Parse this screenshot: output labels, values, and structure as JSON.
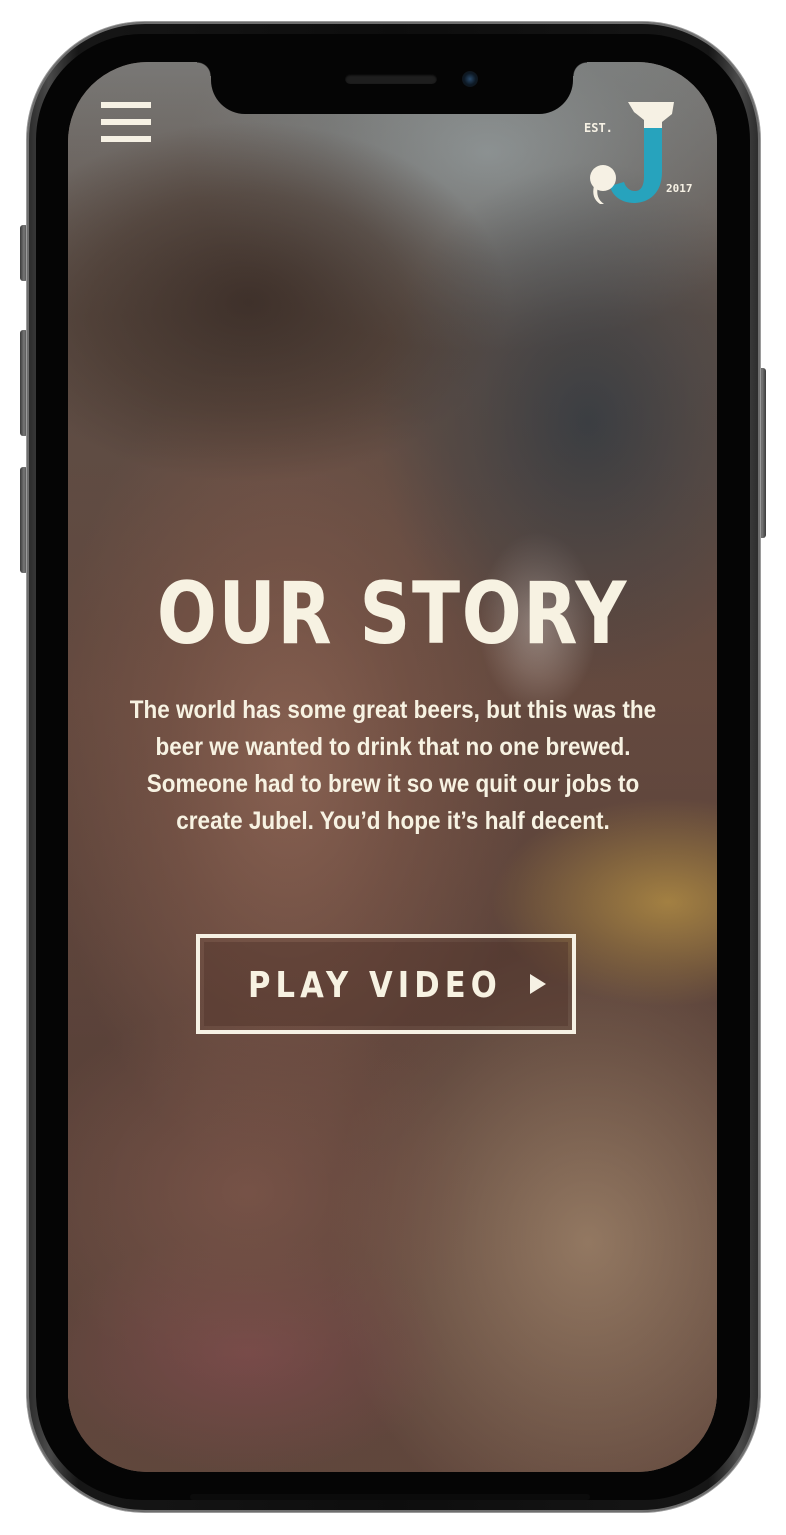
{
  "header": {
    "menu_icon": "hamburger-menu-icon",
    "logo": {
      "est_text": "EST.",
      "year_text": "2017",
      "letter": "J",
      "colors": {
        "cream": "#f6f1e4",
        "teal": "#27a3bd"
      }
    }
  },
  "hero": {
    "title": "OUR STORY",
    "body": "The world has some great beers, but this was the beer we wanted to drink that no one brewed. Someone had to brew it so we quit our jobs to create Jubel. You’d hope it’s half decent."
  },
  "cta": {
    "play_label": "PLAY VIDEO",
    "play_icon": "play-triangle-icon"
  },
  "theme": {
    "text_color": "#f7f2e2",
    "phone_color": "#0d0d0d"
  }
}
